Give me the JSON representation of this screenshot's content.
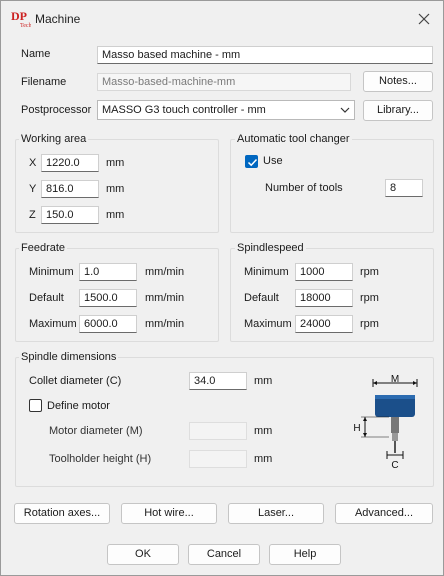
{
  "window": {
    "title": "Machine",
    "logo_text": "DP"
  },
  "form": {
    "name_label": "Name",
    "name_value": "Masso based machine - mm",
    "filename_label": "Filename",
    "filename_value": "Masso-based-machine-mm",
    "notes_button": "Notes...",
    "postprocessor_label": "Postprocessor",
    "postprocessor_value": "MASSO G3 touch controller - mm",
    "library_button": "Library..."
  },
  "working_area": {
    "title": "Working area",
    "x_label": "X",
    "x_value": "1220.0",
    "y_label": "Y",
    "y_value": "816.0",
    "z_label": "Z",
    "z_value": "150.0",
    "unit": "mm"
  },
  "tool_changer": {
    "title": "Automatic tool changer",
    "use_label": "Use",
    "use_checked": true,
    "tools_label": "Number of tools",
    "tools_value": "8"
  },
  "feedrate": {
    "title": "Feedrate",
    "min_label": "Minimum",
    "min_value": "1.0",
    "default_label": "Default",
    "default_value": "1500.0",
    "max_label": "Maximum",
    "max_value": "6000.0",
    "unit": "mm/min"
  },
  "spindlespeed": {
    "title": "Spindlespeed",
    "min_label": "Minimum",
    "min_value": "1000",
    "default_label": "Default",
    "default_value": "18000",
    "max_label": "Maximum",
    "max_value": "24000",
    "unit": "rpm"
  },
  "spindle_dimensions": {
    "title": "Spindle dimensions",
    "collet_label": "Collet diameter (C)",
    "collet_value": "34.0",
    "collet_unit": "mm",
    "define_motor_label": "Define motor",
    "define_motor_checked": false,
    "motor_diameter_label": "Motor diameter (M)",
    "motor_diameter_value": "",
    "motor_diameter_unit": "mm",
    "toolholder_label": "Toolholder height (H)",
    "toolholder_value": "",
    "toolholder_unit": "mm",
    "diagram_labels": {
      "m": "M",
      "h": "H",
      "c": "C"
    }
  },
  "bottom_buttons": {
    "rotation": "Rotation axes...",
    "hot_wire": "Hot wire...",
    "laser": "Laser...",
    "advanced": "Advanced..."
  },
  "dialog_buttons": {
    "ok": "OK",
    "cancel": "Cancel",
    "help": "Help"
  },
  "colors": {
    "accent": "#0067c0",
    "spindle": "#1b4f8a",
    "logo_red": "#cc2222"
  }
}
